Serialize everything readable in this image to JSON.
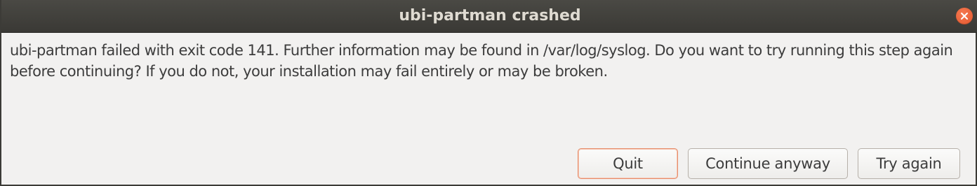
{
  "window": {
    "title": "ubi-partman crashed"
  },
  "dialog": {
    "message": "ubi-partman failed with exit code 141. Further information may be found in /var/log/syslog. Do you want to try running this step again before continuing? If you do not, your installation may fail entirely or may be broken."
  },
  "buttons": {
    "quit": "Quit",
    "continue": "Continue anyway",
    "retry": "Try again"
  },
  "colors": {
    "titlebar": "#3c3b37",
    "close_button": "#e95420",
    "focus_border": "#e68c6a"
  },
  "icons": {
    "close": "close-icon"
  }
}
